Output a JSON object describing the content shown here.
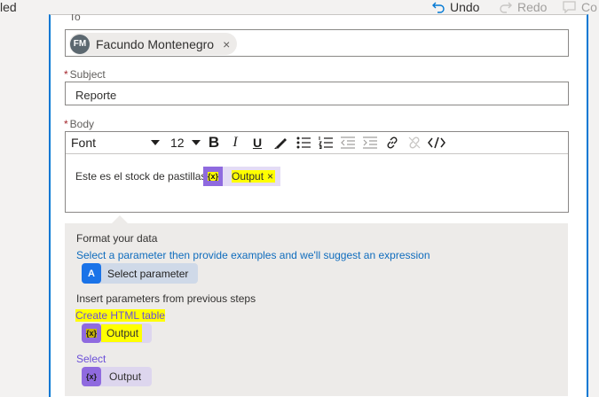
{
  "topbar": {
    "status": "led",
    "undo_label": "Undo",
    "redo_label": "Redo",
    "comment_label": "Co"
  },
  "to_field": {
    "label": "To",
    "recipient": {
      "initials": "FM",
      "name": "Facundo Montenegro",
      "remove": "×"
    }
  },
  "subject_field": {
    "label": "Subject",
    "required_mark": "*",
    "value": "Reporte"
  },
  "body_field": {
    "label": "Body",
    "required_mark": "*",
    "toolbar": {
      "font": "Font",
      "size": "12",
      "bold": "B",
      "italic": "I",
      "underline": "U"
    },
    "text": "Este es el stock de pastillas",
    "token": {
      "icon": "{x}",
      "label": "Output",
      "remove": "×"
    }
  },
  "dynamic_panel": {
    "format_heading": "Format your data",
    "format_link": "Select a parameter then provide examples and we'll suggest an expression",
    "select_parameter": {
      "icon": "A",
      "label": "Select parameter"
    },
    "insert_heading": "Insert parameters from previous steps",
    "groups": [
      {
        "title": "Create HTML table",
        "items": [
          {
            "icon": "{x}",
            "label": "Output"
          }
        ]
      },
      {
        "title": "Select",
        "items": [
          {
            "icon": "{x}",
            "label": "Output"
          }
        ]
      }
    ]
  },
  "colors": {
    "accent_blue": "#0078d4",
    "token_purple": "#8f6adf",
    "highlight_yellow": "#ffff00",
    "panel_gray": "#edebe9",
    "link_blue": "#0f6cbd",
    "select_purple": "#6b4fd8"
  }
}
